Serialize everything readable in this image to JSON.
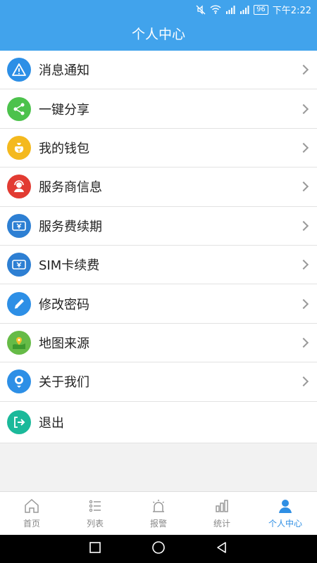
{
  "status": {
    "battery": "96",
    "time": "下午2:22"
  },
  "header": {
    "title": "个人中心"
  },
  "menu": [
    {
      "label": "消息通知",
      "icon": "alert-triangle-icon",
      "color": "#2d8fe6",
      "chevron": true
    },
    {
      "label": "一键分享",
      "icon": "share-icon",
      "color": "#4cc24c",
      "chevron": true
    },
    {
      "label": "我的钱包",
      "icon": "wallet-icon",
      "color": "#f4b91e",
      "chevron": true
    },
    {
      "label": "服务商信息",
      "icon": "headset-person-icon",
      "color": "#e23b32",
      "chevron": true
    },
    {
      "label": "服务费续期",
      "icon": "yuan-ticket-icon",
      "color": "#2d7fd3",
      "chevron": true
    },
    {
      "label": "SIM卡续费",
      "icon": "yuan-ticket-icon",
      "color": "#2d7fd3",
      "chevron": true
    },
    {
      "label": "修改密码",
      "icon": "pencil-icon",
      "color": "#2d8fe6",
      "chevron": true
    },
    {
      "label": "地图来源",
      "icon": "map-pin-icon",
      "color": "#66bb47",
      "chevron": true
    },
    {
      "label": "关于我们",
      "icon": "person-bubble-icon",
      "color": "#2d8fe6",
      "chevron": true
    },
    {
      "label": "退出",
      "icon": "logout-icon",
      "color": "#1bb99a",
      "chevron": false
    }
  ],
  "tabs": [
    {
      "label": "首页",
      "icon": "home-icon",
      "active": false
    },
    {
      "label": "列表",
      "icon": "list-icon",
      "active": false
    },
    {
      "label": "报警",
      "icon": "alarm-light-icon",
      "active": false
    },
    {
      "label": "统计",
      "icon": "bar-chart-icon",
      "active": false
    },
    {
      "label": "个人中心",
      "icon": "person-icon",
      "active": true
    }
  ],
  "colors": {
    "primary": "#41a3ec",
    "tab_active": "#2f8fe4",
    "tab_inactive": "#888888"
  }
}
